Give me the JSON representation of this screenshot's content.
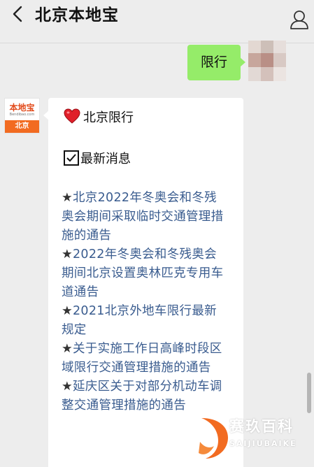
{
  "header": {
    "title": "北京本地宝"
  },
  "chat": {
    "my_message": "限行",
    "bot": {
      "logo_name": "本地宝",
      "logo_domain": "Bendibao.com",
      "logo_city": "北京"
    },
    "card": {
      "heading": "北京限行",
      "subhead": "最新消息",
      "items": [
        "★北京2022年冬奥会和冬残奥会期间采取临时交通管理措施的通告",
        "★2022年冬奥会和冬残奥会期间北京设置奥林匹克专用车道通告",
        "★2021北京外地车限行最新规定",
        "★关于实施工作日高峰时段区域限行交通管理措施的通告",
        "★延庆区关于对部分机动车调整交通管理措施的通告"
      ]
    }
  },
  "watermark": {
    "name": "赛玖百科",
    "latin": "SAIJIUBAIKE"
  },
  "colors": {
    "bubble_green": "#95ec69",
    "brand_orange": "#f26b21",
    "link_blue": "#3a5c8f",
    "background": "#ededed"
  },
  "icons": [
    "back-arrow-icon",
    "user-icon",
    "heart-icon",
    "checkbox-icon",
    "wave-icon"
  ]
}
